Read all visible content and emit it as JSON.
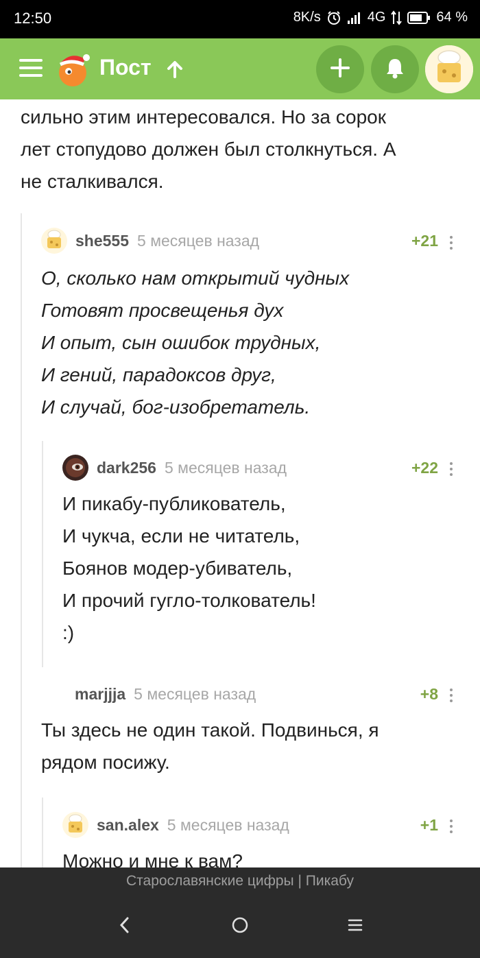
{
  "status_bar": {
    "time": "12:50",
    "network_speed": "8K/s",
    "network_type": "4G",
    "battery": "64 %"
  },
  "header": {
    "title": "Пост",
    "icons": [
      "menu-icon",
      "logo-icon",
      "arrow-up-icon",
      "plus-icon",
      "bell-icon",
      "avatar"
    ],
    "accent_color": "#8ac858"
  },
  "post": {
    "lines": [
      "сильно этим интересовался. Но за сорок",
      "лет стопудово должен был столкнуться. А",
      "не сталкивался."
    ]
  },
  "comments": [
    {
      "author": "she555",
      "time": "5 месяцев назад",
      "rating": "+21",
      "avatar": "default-avatar",
      "lines": [
        "О, сколько нам открытий чудных",
        "Готовят просвещенья дух",
        "И опыт, сын ошибок трудных,",
        "И гений, парадоксов друг,",
        "И случай, бог-изобретатель."
      ]
    },
    {
      "author": "dark256",
      "time": "5 месяцев назад",
      "rating": "+22",
      "avatar": "photo-avatar",
      "lines": [
        "И пикабу-публикователь,",
        "И чукча, если не читатель,",
        "Боянов модер-убиватель,",
        "И прочий гугло-толкователь!",
        ":)"
      ]
    },
    {
      "author": "marjjja",
      "time": "5 месяцев назад",
      "rating": "+8",
      "avatar": "none",
      "lines": [
        "Ты здесь не один такой. Подвинься, я",
        "рядом посижу."
      ]
    },
    {
      "author": "san.alex",
      "time": "5 месяцев назад",
      "rating": "+1",
      "avatar": "default-avatar",
      "lines": [
        "Можно и мне к вам?"
      ]
    }
  ],
  "footer": {
    "page_title": "Старославянские цифры | Пикабу"
  },
  "nav": {
    "icons": [
      "back-icon",
      "home-icon",
      "recents-icon"
    ]
  },
  "colors": {
    "rating": "#7fa444",
    "time": "#a7a7a7",
    "bottom_bar": "#2b2b2b"
  }
}
